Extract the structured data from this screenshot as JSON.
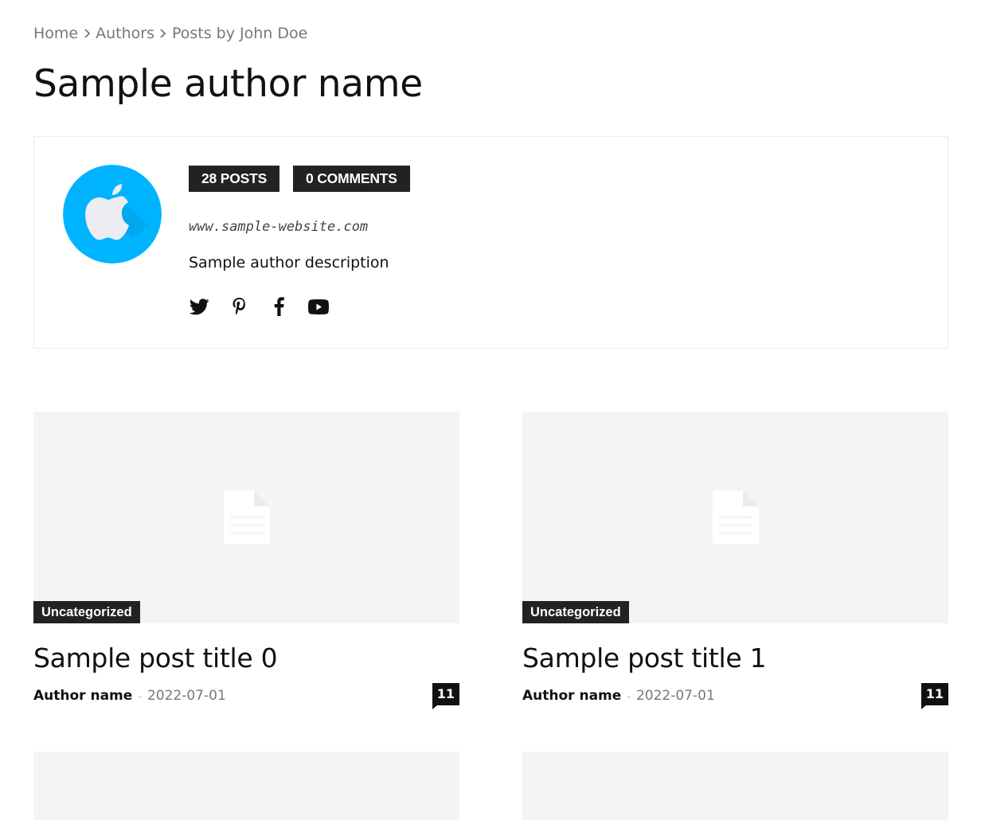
{
  "breadcrumb": {
    "items": [
      "Home",
      "Authors",
      "Posts by John Doe"
    ]
  },
  "page": {
    "title": "Sample author name"
  },
  "author": {
    "avatar_icon": "apple-logo-icon",
    "avatar_bg": "#00b3ff",
    "posts_badge": "28 POSTS",
    "comments_badge": "0 COMMENTS",
    "website": "www.sample-website.com",
    "description": "Sample author description",
    "socials": [
      "twitter-icon",
      "pinterest-icon",
      "facebook-icon",
      "youtube-icon"
    ]
  },
  "posts": [
    {
      "category": "Uncategorized",
      "title": "Sample post title 0",
      "author": "Author name",
      "separator": "-",
      "date": "2022-07-01",
      "comments": "11"
    },
    {
      "category": "Uncategorized",
      "title": "Sample post title 1",
      "author": "Author name",
      "separator": "-",
      "date": "2022-07-01",
      "comments": "11"
    }
  ],
  "colors": {
    "dark": "#222222",
    "thumb_bg": "#f4f4f4",
    "muted_text": "#777777"
  }
}
